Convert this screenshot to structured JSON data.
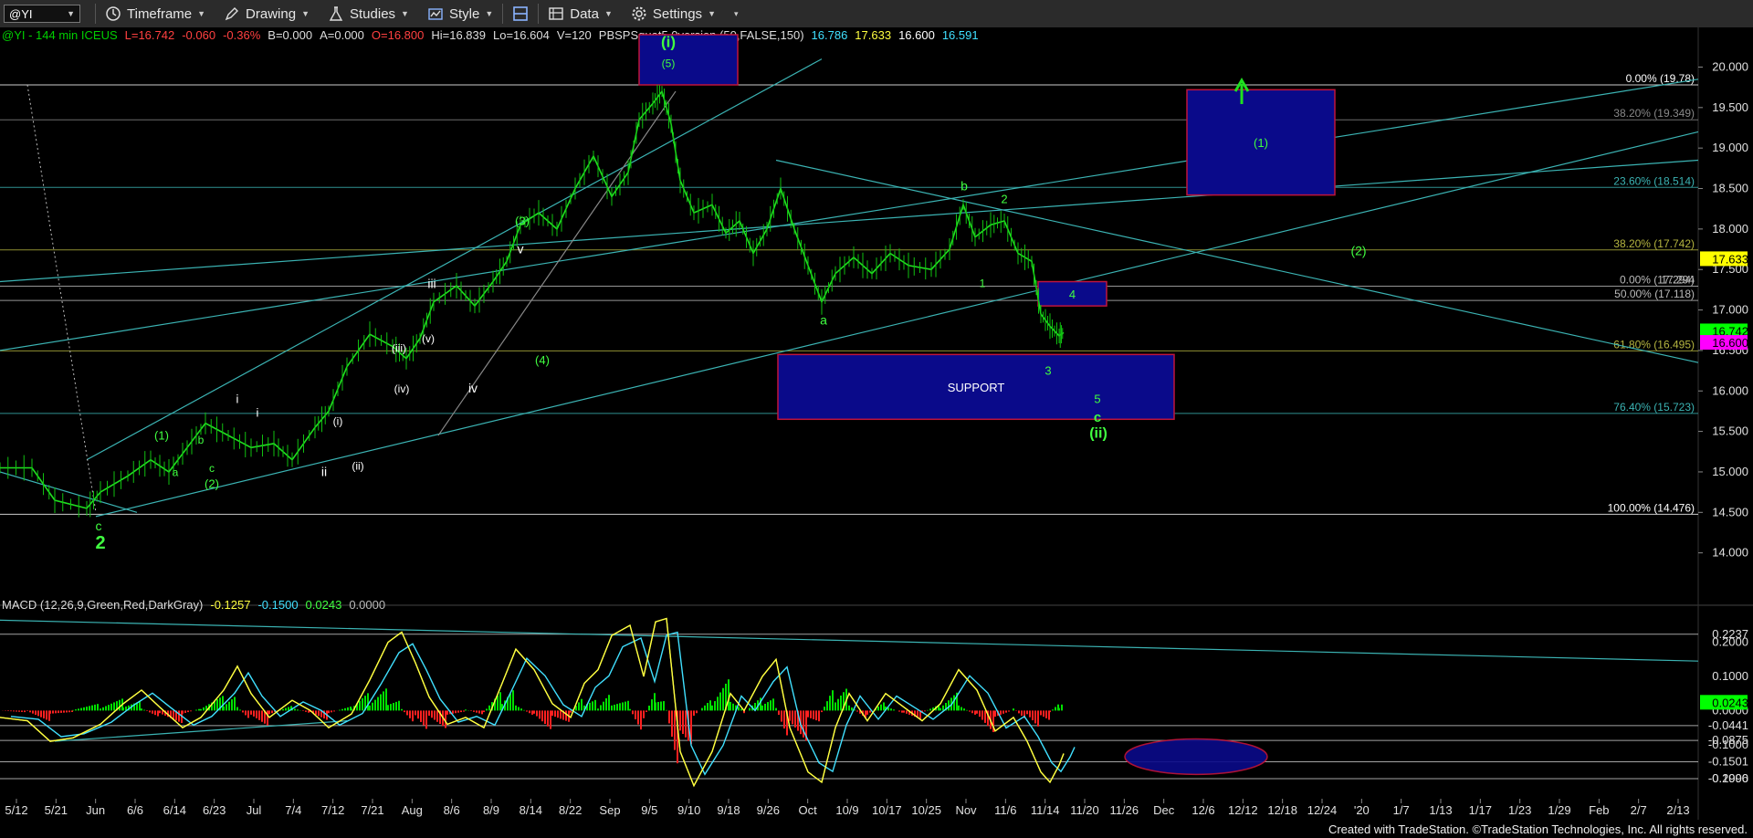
{
  "toolbar": {
    "symbol": "@YI",
    "timeframe": "Timeframe",
    "drawing": "Drawing",
    "studies": "Studies",
    "style": "Style",
    "data": "Data",
    "settings": "Settings"
  },
  "header": {
    "parts": [
      {
        "text": "@YI - 144 min  ICEUS",
        "color": "#00d000"
      },
      {
        "text": "L=16.742",
        "color": "#ff4040"
      },
      {
        "text": "-0.060",
        "color": "#ff4040"
      },
      {
        "text": "-0.36%",
        "color": "#ff4040"
      },
      {
        "text": "B=0.000",
        "color": "#dddddd"
      },
      {
        "text": "A=0.000",
        "color": "#dddddd"
      },
      {
        "text": "O=16.800",
        "color": "#ff4040"
      },
      {
        "text": "Hi=16.839",
        "color": "#dddddd"
      },
      {
        "text": "Lo=16.604",
        "color": "#dddddd"
      },
      {
        "text": "V=120",
        "color": "#dddddd"
      },
      {
        "text": "PBSPSquat5.0version (50,FALSE,150)",
        "color": "#dddddd"
      },
      {
        "text": "16.786",
        "color": "#40e0ff"
      },
      {
        "text": "17.633",
        "color": "#ffff40"
      },
      {
        "text": "16.600",
        "color": "#ffffff"
      },
      {
        "text": "16.591",
        "color": "#40e0ff"
      }
    ]
  },
  "macd_header": {
    "parts": [
      {
        "text": "MACD (12,26,9,Green,Red,DarkGray)",
        "color": "#dddddd"
      },
      {
        "text": "-0.1257",
        "color": "#ffff40"
      },
      {
        "text": "-0.1500",
        "color": "#40e0ff"
      },
      {
        "text": "0.0243",
        "color": "#40ff40"
      },
      {
        "text": "0.0000",
        "color": "#bbbbbb"
      }
    ]
  },
  "footer": "Created with TradeStation. ©TradeStation Technologies, Inc. All rights reserved.",
  "chart_data": [
    {
      "type": "line",
      "name": "price",
      "ylim": [
        13.5,
        20.4
      ],
      "y_ticks": [
        14.0,
        14.5,
        15.0,
        15.5,
        16.0,
        16.5,
        17.0,
        17.5,
        18.0,
        18.5,
        19.0,
        19.5,
        20.0
      ],
      "x_ticks": [
        "5/12",
        "5/21",
        "Jun",
        "6/6",
        "6/14",
        "6/23",
        "Jul",
        "7/4",
        "7/12",
        "7/21",
        "Aug",
        "8/6",
        "8/9",
        "8/14",
        "8/22",
        "Sep",
        "9/5",
        "9/10",
        "9/18",
        "9/26",
        "Oct",
        "10/9",
        "10/17",
        "10/25",
        "Nov",
        "11/6",
        "11/14",
        "11/20",
        "11/26",
        "Dec",
        "12/6",
        "12/12",
        "12/18",
        "12/24",
        "'20",
        "1/7",
        "1/13",
        "1/17",
        "1/23",
        "1/29",
        "Feb",
        "2/7",
        "2/13"
      ],
      "x_range": [
        0,
        1860
      ],
      "path": [
        [
          0,
          15.05
        ],
        [
          35,
          15.05
        ],
        [
          60,
          14.65
        ],
        [
          95,
          14.55
        ],
        [
          110,
          14.75
        ],
        [
          140,
          14.95
        ],
        [
          165,
          15.15
        ],
        [
          185,
          15.0
        ],
        [
          205,
          15.3
        ],
        [
          225,
          15.6
        ],
        [
          250,
          15.45
        ],
        [
          275,
          15.3
        ],
        [
          300,
          15.35
        ],
        [
          320,
          15.15
        ],
        [
          345,
          15.55
        ],
        [
          360,
          15.75
        ],
        [
          380,
          16.3
        ],
        [
          405,
          16.7
        ],
        [
          430,
          16.55
        ],
        [
          445,
          16.4
        ],
        [
          460,
          16.65
        ],
        [
          475,
          17.1
        ],
        [
          500,
          17.3
        ],
        [
          520,
          17.05
        ],
        [
          540,
          17.35
        ],
        [
          555,
          17.6
        ],
        [
          570,
          18.05
        ],
        [
          590,
          18.2
        ],
        [
          610,
          18.0
        ],
        [
          630,
          18.5
        ],
        [
          650,
          18.9
        ],
        [
          670,
          18.4
        ],
        [
          688,
          18.7
        ],
        [
          700,
          19.35
        ],
        [
          715,
          19.55
        ],
        [
          725,
          19.7
        ],
        [
          735,
          19.3
        ],
        [
          745,
          18.6
        ],
        [
          760,
          18.2
        ],
        [
          780,
          18.3
        ],
        [
          795,
          17.95
        ],
        [
          810,
          18.1
        ],
        [
          825,
          17.7
        ],
        [
          840,
          18.0
        ],
        [
          855,
          18.5
        ],
        [
          870,
          18.0
        ],
        [
          885,
          17.55
        ],
        [
          900,
          17.1
        ],
        [
          915,
          17.45
        ],
        [
          935,
          17.65
        ],
        [
          955,
          17.45
        ],
        [
          975,
          17.7
        ],
        [
          995,
          17.55
        ],
        [
          1020,
          17.5
        ],
        [
          1040,
          17.75
        ],
        [
          1055,
          18.3
        ],
        [
          1068,
          17.9
        ],
        [
          1085,
          18.05
        ],
        [
          1100,
          18.1
        ],
        [
          1115,
          17.7
        ],
        [
          1130,
          17.6
        ],
        [
          1140,
          16.95
        ],
        [
          1150,
          16.8
        ],
        [
          1160,
          16.68
        ],
        [
          1165,
          16.72
        ]
      ],
      "axis_labels": [
        {
          "value": "20.000",
          "y": 20.0
        },
        {
          "value": "19.500",
          "y": 19.5
        },
        {
          "value": "19.000",
          "y": 19.0
        },
        {
          "value": "18.500",
          "y": 18.5
        },
        {
          "value": "18.000",
          "y": 18.0
        },
        {
          "value": "17.500",
          "y": 17.5
        },
        {
          "value": "17.000",
          "y": 17.0
        },
        {
          "value": "16.500",
          "y": 16.5
        },
        {
          "value": "16.000",
          "y": 16.0
        },
        {
          "value": "15.500",
          "y": 15.5
        },
        {
          "value": "15.000",
          "y": 15.0
        },
        {
          "value": "14.500",
          "y": 14.5
        },
        {
          "value": "14.000",
          "y": 14.0
        }
      ],
      "price_flags": [
        {
          "value": "17.633",
          "y": 17.633,
          "color": "#ffff00",
          "text_color": "#000000"
        },
        {
          "value": "16.742",
          "y": 16.742,
          "color": "#00ff00",
          "text_color": "#000000"
        },
        {
          "value": "16.600",
          "y": 16.6,
          "color": "#ff00ff",
          "text_color": "#000000"
        }
      ],
      "levels": [
        {
          "label": "0.00% (19.78)",
          "y": 19.78,
          "color": "#ffffff"
        },
        {
          "label": "38.20% (19.349)",
          "y": 19.349,
          "color": "#888888"
        },
        {
          "label": "23.60% (18.514)",
          "y": 18.514,
          "color": "#3bb3b3"
        },
        {
          "label": "38.20% (17.742)",
          "y": 17.742,
          "color": "#b5b540"
        },
        {
          "label": "0.00% (17.294)",
          "y": 17.294,
          "color": "#bbbbbb"
        },
        {
          "label": "17.294",
          "y": 17.294,
          "color": "#bbbbbb"
        },
        {
          "label": "50.00% (17.118)",
          "y": 17.118,
          "color": "#bbbbbb"
        },
        {
          "label": "61.80% (16.495)",
          "y": 16.495,
          "color": "#b5b540"
        },
        {
          "label": "76.40% (15.723)",
          "y": 15.723,
          "color": "#3bb3b3"
        },
        {
          "label": "100.00% (14.476)",
          "y": 14.476,
          "color": "#ffffff"
        }
      ],
      "boxes": [
        {
          "label": "",
          "x0": 700,
          "x1": 808,
          "y0": 20.4,
          "y1": 19.78
        },
        {
          "label": "(1)",
          "x0": 1300,
          "x1": 1462,
          "y0": 19.72,
          "y1": 18.42
        },
        {
          "label": "4",
          "x0": 1137,
          "x1": 1212,
          "y0": 17.35,
          "y1": 17.05
        },
        {
          "label": "SUPPORT",
          "x0": 852,
          "x1": 1286,
          "y0": 16.45,
          "y1": 15.65
        }
      ],
      "wave_labels": [
        {
          "text": "c",
          "x": 108,
          "y": 14.28,
          "color": "#40ff40",
          "size": 14
        },
        {
          "text": "2",
          "x": 110,
          "y": 14.05,
          "color": "#40ff40",
          "size": 20
        },
        {
          "text": "(1)",
          "x": 177,
          "y": 15.4,
          "color": "#40ff40",
          "size": 13
        },
        {
          "text": "(2)",
          "x": 232,
          "y": 14.8,
          "color": "#40ff40",
          "size": 13
        },
        {
          "text": "a",
          "x": 192,
          "y": 14.95,
          "color": "#40ff40",
          "size": 12
        },
        {
          "text": "b",
          "x": 220,
          "y": 15.35,
          "color": "#40ff40",
          "size": 12
        },
        {
          "text": "c",
          "x": 232,
          "y": 15.0,
          "color": "#40ff40",
          "size": 12
        },
        {
          "text": "i",
          "x": 260,
          "y": 15.85,
          "color": "#ffffff",
          "size": 13
        },
        {
          "text": "i",
          "x": 282,
          "y": 15.68,
          "color": "#ffffff",
          "size": 13
        },
        {
          "text": "ii",
          "x": 355,
          "y": 14.95,
          "color": "#ffffff",
          "size": 14
        },
        {
          "text": "(i)",
          "x": 370,
          "y": 15.58,
          "color": "#ffffff",
          "size": 12
        },
        {
          "text": "(ii)",
          "x": 392,
          "y": 15.03,
          "color": "#ffffff",
          "size": 12
        },
        {
          "text": "(iii)",
          "x": 437,
          "y": 16.48,
          "color": "#ffffff",
          "size": 12
        },
        {
          "text": "(iv)",
          "x": 440,
          "y": 15.98,
          "color": "#ffffff",
          "size": 12
        },
        {
          "text": "(v)",
          "x": 469,
          "y": 16.6,
          "color": "#ffffff",
          "size": 12
        },
        {
          "text": "iii",
          "x": 473,
          "y": 17.27,
          "color": "#ffffff",
          "size": 14
        },
        {
          "text": "iv",
          "x": 518,
          "y": 15.98,
          "color": "#ffffff",
          "size": 14
        },
        {
          "text": "v",
          "x": 570,
          "y": 17.7,
          "color": "#ffffff",
          "size": 14
        },
        {
          "text": "(3)",
          "x": 572,
          "y": 18.05,
          "color": "#40ff40",
          "size": 13
        },
        {
          "text": "(4)",
          "x": 594,
          "y": 16.33,
          "color": "#40ff40",
          "size": 13
        },
        {
          "text": "(i)",
          "x": 732,
          "y": 20.25,
          "color": "#40ff40",
          "size": 17
        },
        {
          "text": "(5)",
          "x": 732,
          "y": 20.0,
          "color": "#40ff40",
          "size": 12
        },
        {
          "text": "a",
          "x": 902,
          "y": 16.82,
          "color": "#40ff40",
          "size": 14
        },
        {
          "text": "b",
          "x": 1056,
          "y": 18.48,
          "color": "#40ff40",
          "size": 14
        },
        {
          "text": "2",
          "x": 1100,
          "y": 18.32,
          "color": "#40ff40",
          "size": 13
        },
        {
          "text": "1",
          "x": 1076,
          "y": 17.28,
          "color": "#40ff40",
          "size": 12
        },
        {
          "text": "3",
          "x": 1148,
          "y": 16.2,
          "color": "#40ff40",
          "size": 13
        },
        {
          "text": "5",
          "x": 1202,
          "y": 15.85,
          "color": "#40ff40",
          "size": 13
        },
        {
          "text": "c",
          "x": 1202,
          "y": 15.62,
          "color": "#40ff40",
          "size": 15
        },
        {
          "text": "(ii)",
          "x": 1203,
          "y": 15.42,
          "color": "#40ff40",
          "size": 16
        },
        {
          "text": "(2)",
          "x": 1488,
          "y": 17.68,
          "color": "#40ff40",
          "size": 14
        }
      ],
      "trendlines": [
        {
          "p": [
            [
              0,
              15.0
            ],
            [
              150,
              14.5
            ]
          ],
          "color": "#3bb3b3"
        },
        {
          "p": [
            [
              105,
              14.45
            ],
            [
              1860,
              19.2
            ]
          ],
          "color": "#3bb3b3"
        },
        {
          "p": [
            [
              0,
              16.5
            ],
            [
              1860,
              19.85
            ]
          ],
          "color": "#3bb3b3"
        },
        {
          "p": [
            [
              0,
              17.35
            ],
            [
              1860,
              18.85
            ]
          ],
          "color": "#3bb3b3"
        },
        {
          "p": [
            [
              850,
              18.85
            ],
            [
              1860,
              16.35
            ]
          ],
          "color": "#3bb3b3"
        },
        {
          "p": [
            [
              95,
              15.15
            ],
            [
              900,
              20.1
            ]
          ],
          "color": "#3bb3b3"
        },
        {
          "p": [
            [
              480,
              15.45
            ],
            [
              740,
              19.7
            ]
          ],
          "color": "#888888"
        }
      ]
    },
    {
      "type": "line",
      "name": "macd",
      "ylim": [
        -0.245,
        0.29
      ],
      "y_ticks": [
        -0.2,
        -0.1,
        0.0,
        0.1,
        0.2
      ],
      "axis_labels": [
        {
          "value": "0.2237",
          "y": 0.2237
        },
        {
          "value": "0.2000",
          "y": 0.2
        },
        {
          "value": "0.1000",
          "y": 0.1
        },
        {
          "value": "0.0000",
          "y": 0.0
        },
        {
          "value": "-0.0441",
          "y": -0.0441
        },
        {
          "value": "-0.0875",
          "y": -0.0875
        },
        {
          "value": "-0.1000",
          "y": -0.1
        },
        {
          "value": "-0.1501",
          "y": -0.1501
        },
        {
          "value": "-0.1996",
          "y": -0.1996
        },
        {
          "value": "-0.2000",
          "y": -0.2
        }
      ],
      "flags": [
        {
          "value": "0.0243",
          "y": 0.0243,
          "color": "#00ff00"
        }
      ],
      "levels": [
        0.2237,
        -0.0441,
        -0.0875,
        -0.1501,
        -0.1996
      ],
      "macd": [
        [
          0,
          -0.02
        ],
        [
          30,
          -0.03
        ],
        [
          55,
          -0.09
        ],
        [
          80,
          -0.08
        ],
        [
          110,
          -0.04
        ],
        [
          135,
          0.02
        ],
        [
          155,
          0.06
        ],
        [
          175,
          0.01
        ],
        [
          200,
          -0.05
        ],
        [
          220,
          -0.02
        ],
        [
          245,
          0.06
        ],
        [
          260,
          0.13
        ],
        [
          275,
          0.05
        ],
        [
          295,
          -0.02
        ],
        [
          320,
          0.03
        ],
        [
          340,
          0.0
        ],
        [
          360,
          -0.05
        ],
        [
          385,
          -0.01
        ],
        [
          405,
          0.09
        ],
        [
          425,
          0.2
        ],
        [
          440,
          0.23
        ],
        [
          455,
          0.14
        ],
        [
          470,
          0.04
        ],
        [
          490,
          -0.04
        ],
        [
          510,
          -0.02
        ],
        [
          530,
          -0.05
        ],
        [
          550,
          0.08
        ],
        [
          565,
          0.18
        ],
        [
          585,
          0.12
        ],
        [
          605,
          0.02
        ],
        [
          625,
          -0.02
        ],
        [
          640,
          0.08
        ],
        [
          655,
          0.12
        ],
        [
          670,
          0.22
        ],
        [
          690,
          0.25
        ],
        [
          705,
          0.1
        ],
        [
          718,
          0.26
        ],
        [
          730,
          0.27
        ],
        [
          745,
          -0.12
        ],
        [
          760,
          -0.22
        ],
        [
          780,
          -0.12
        ],
        [
          800,
          0.05
        ],
        [
          815,
          0.0
        ],
        [
          835,
          0.1
        ],
        [
          850,
          0.15
        ],
        [
          865,
          -0.05
        ],
        [
          885,
          -0.18
        ],
        [
          900,
          -0.21
        ],
        [
          915,
          -0.05
        ],
        [
          930,
          0.05
        ],
        [
          950,
          -0.03
        ],
        [
          970,
          0.05
        ],
        [
          990,
          0.01
        ],
        [
          1010,
          -0.03
        ],
        [
          1030,
          0.02
        ],
        [
          1050,
          0.12
        ],
        [
          1070,
          0.06
        ],
        [
          1090,
          -0.06
        ],
        [
          1110,
          -0.02
        ],
        [
          1125,
          -0.09
        ],
        [
          1140,
          -0.18
        ],
        [
          1150,
          -0.21
        ],
        [
          1160,
          -0.16
        ],
        [
          1165,
          -0.126
        ]
      ],
      "signal_offset": 12,
      "ellipse": {
        "cx": 1310,
        "cy": -0.135,
        "rx": 78,
        "ry": 0.052
      }
    }
  ]
}
